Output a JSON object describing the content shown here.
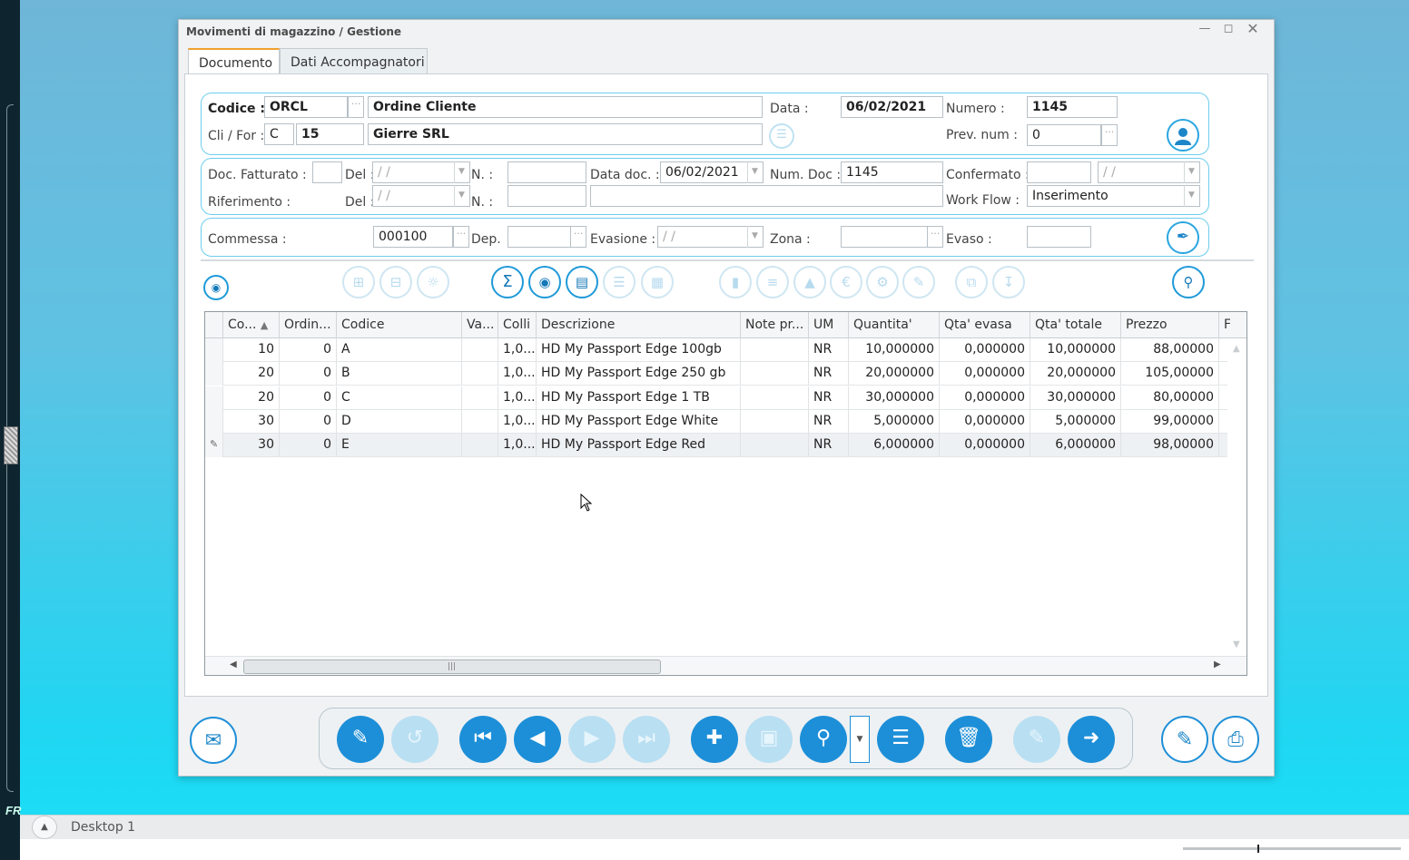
{
  "window": {
    "title": "Movimenti di magazzino / Gestione",
    "controls": [
      "minimize-icon",
      "maximize-icon",
      "close-icon"
    ]
  },
  "tabs": [
    {
      "label": "Documento",
      "active": true
    },
    {
      "label": "Dati Accompagnatori",
      "active": false
    }
  ],
  "header": {
    "codice_label": "Codice :",
    "codice_value": "ORCL",
    "codice_desc": "Ordine Cliente",
    "data_label": "Data :",
    "data_value": "06/02/2021",
    "numero_label": "Numero :",
    "numero_value": "1145",
    "clifor_label": "Cli / For :",
    "clifor_type": "C",
    "clifor_code": "15",
    "clifor_name": "Gierre SRL",
    "prevnum_label": "Prev. num :",
    "prevnum_value": "0"
  },
  "doc": {
    "fatturato_label": "Doc. Fatturato :",
    "del_label": "Del :",
    "del_value": " /  /",
    "n_label": "N. :",
    "datadoc_label": "Data doc. :",
    "datadoc_value": "06/02/2021",
    "numdoc_label": "Num. Doc :",
    "numdoc_value": "1145",
    "confermato_label": "Confermato :",
    "confermato_date": " /  /",
    "riferimento_label": "Riferimento :",
    "del2_label": "Del :",
    "del2_value": " /  /",
    "n2_label": "N. :",
    "workflow_label": "Work Flow :",
    "workflow_value": "Inserimento"
  },
  "commessa": {
    "commessa_label": "Commessa :",
    "commessa_value": "000100",
    "dep_label": "Dep.",
    "evasione_label": "Evasione :",
    "evasione_value": " /  /",
    "zona_label": "Zona :",
    "evaso_label": "Evaso :"
  },
  "grid": {
    "columns": [
      "Co...",
      "Ordin...",
      "Codice",
      "Va...",
      "Colli",
      "Descrizione",
      "Note pr...",
      "UM",
      "Quantita'",
      "Qta' evasa",
      "Qta' totale",
      "Prezzo",
      "F"
    ],
    "rows": [
      {
        "co": "10",
        "ordin": "0",
        "codice": "A",
        "va": "",
        "colli": "1,0...",
        "desc": "HD My Passport Edge 100gb",
        "note": "",
        "um": "NR",
        "qta": "10,000000",
        "evasa": "0,000000",
        "totale": "10,000000",
        "prezzo": "88,00000"
      },
      {
        "co": "20",
        "ordin": "0",
        "codice": "B",
        "va": "",
        "colli": "1,0...",
        "desc": "HD My Passport Edge 250 gb",
        "note": "",
        "um": "NR",
        "qta": "20,000000",
        "evasa": "0,000000",
        "totale": "20,000000",
        "prezzo": "105,00000"
      },
      {
        "co": "20",
        "ordin": "0",
        "codice": "C",
        "va": "",
        "colli": "1,0...",
        "desc": "HD My Passport Edge 1 TB",
        "note": "",
        "um": "NR",
        "qta": "30,000000",
        "evasa": "0,000000",
        "totale": "30,000000",
        "prezzo": "80,00000"
      },
      {
        "co": "30",
        "ordin": "0",
        "codice": "D",
        "va": "",
        "colli": "1,0...",
        "desc": "HD My Passport Edge White",
        "note": "",
        "um": "NR",
        "qta": "5,000000",
        "evasa": "0,000000",
        "totale": "5,000000",
        "prezzo": "99,00000"
      },
      {
        "co": "30",
        "ordin": "0",
        "codice": "E",
        "va": "",
        "colli": "1,0...",
        "desc": "HD My Passport Edge Red",
        "note": "",
        "um": "NR",
        "qta": "6,000000",
        "evasa": "0,000000",
        "totale": "6,000000",
        "prezzo": "98,00000"
      }
    ]
  },
  "taskbar": {
    "desktop_label": "Desktop 1"
  },
  "sidebar": {
    "logo_text": "FR"
  },
  "colors": {
    "accent": "#1d8fd8",
    "group_border": "#6ccdee",
    "desktop_bg": "#20d6f2"
  }
}
